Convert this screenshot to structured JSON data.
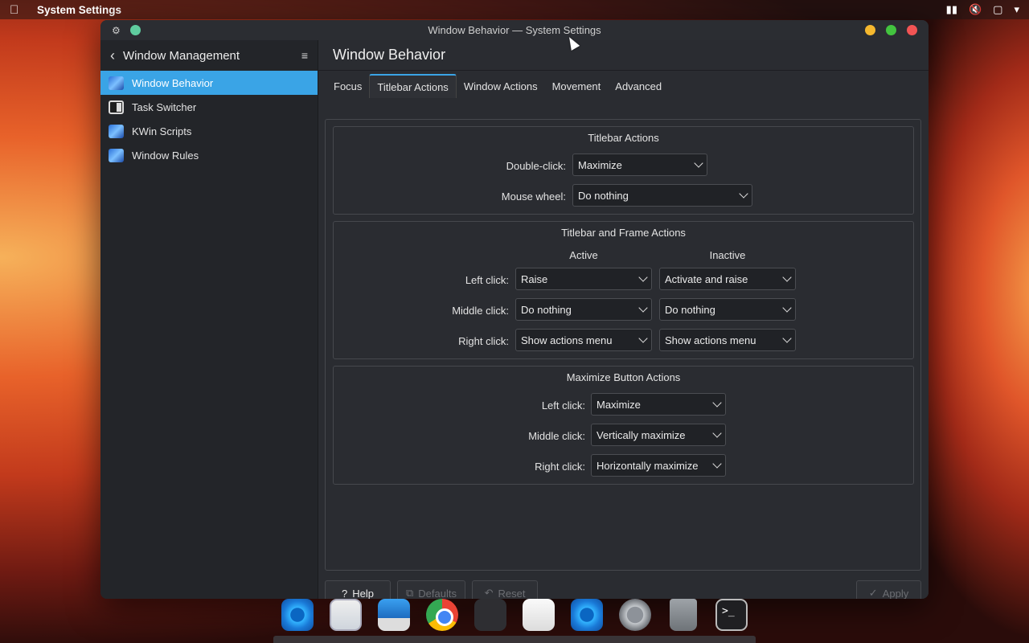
{
  "menubar": {
    "app_name": "System Settings"
  },
  "window": {
    "title": "Window Behavior — System Settings"
  },
  "sidebar": {
    "header": "Window Management",
    "items": [
      {
        "label": "Window Behavior",
        "icon": "window-behavior-icon",
        "active": true
      },
      {
        "label": "Task Switcher",
        "icon": "task-switcher-icon",
        "active": false
      },
      {
        "label": "KWin Scripts",
        "icon": "kwin-scripts-icon",
        "active": false
      },
      {
        "label": "Window Rules",
        "icon": "window-rules-icon",
        "active": false
      }
    ]
  },
  "main": {
    "title": "Window Behavior",
    "tabs": [
      {
        "label": "Focus",
        "active": false
      },
      {
        "label": "Titlebar Actions",
        "active": true
      },
      {
        "label": "Window Actions",
        "active": false
      },
      {
        "label": "Movement",
        "active": false
      },
      {
        "label": "Advanced",
        "active": false
      }
    ]
  },
  "titlebar_actions": {
    "title": "Titlebar Actions",
    "double_click_label": "Double-click:",
    "double_click_value": "Maximize",
    "mouse_wheel_label": "Mouse wheel:",
    "mouse_wheel_value": "Do nothing"
  },
  "frame_actions": {
    "title": "Titlebar and Frame Actions",
    "col_active": "Active",
    "col_inactive": "Inactive",
    "left_label": "Left click:",
    "left_active": "Raise",
    "left_inactive": "Activate and raise",
    "middle_label": "Middle click:",
    "middle_active": "Do nothing",
    "middle_inactive": "Do nothing",
    "right_label": "Right click:",
    "right_active": "Show actions menu",
    "right_inactive": "Show actions menu"
  },
  "maximize_actions": {
    "title": "Maximize Button Actions",
    "left_label": "Left click:",
    "left_value": "Maximize",
    "middle_label": "Middle click:",
    "middle_value": "Vertically maximize",
    "right_label": "Right click:",
    "right_value": "Horizontally maximize"
  },
  "footer": {
    "help": "Help",
    "defaults": "Defaults",
    "reset": "Reset",
    "apply": "Apply"
  },
  "colors": {
    "accent": "#3aa4e6",
    "window_bg": "#2a2c31",
    "sidebar_bg": "#232529"
  },
  "dock": {
    "terminal_glyph": ">_"
  }
}
